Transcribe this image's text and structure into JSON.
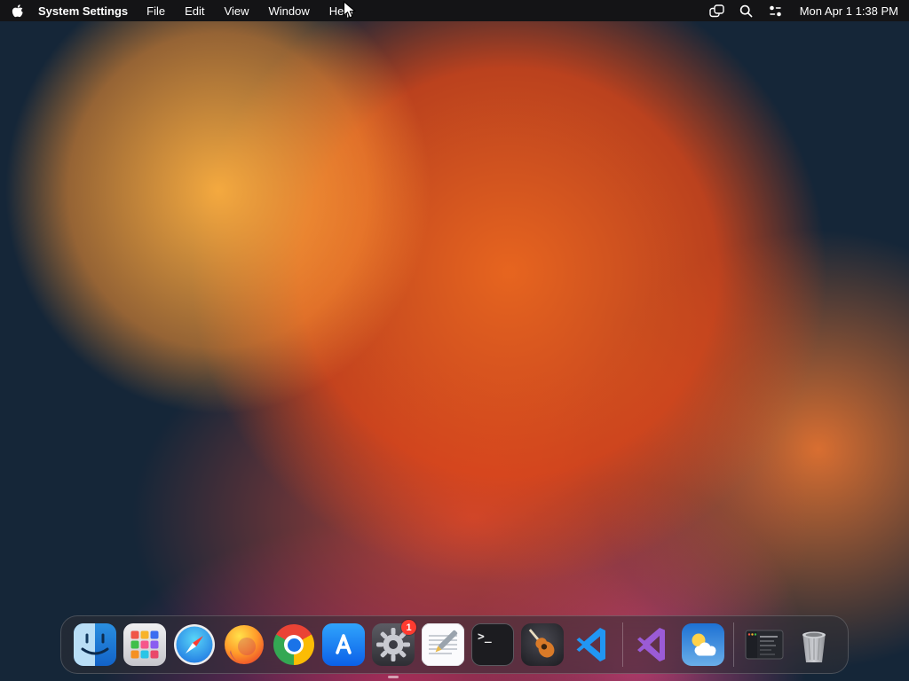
{
  "menubar": {
    "app_name": "System Settings",
    "menus": [
      {
        "label": "File"
      },
      {
        "label": "Edit"
      },
      {
        "label": "View"
      },
      {
        "label": "Window"
      },
      {
        "label": "Help"
      }
    ],
    "status_icons": [
      "stage-manager-icon",
      "search-icon",
      "control-center-icon"
    ],
    "status": {
      "clock": "Mon Apr 1 1:38 PM"
    }
  },
  "dock": {
    "settings_badge": "1",
    "terminal_glyph": ">_",
    "items": [
      {
        "name": "finder"
      },
      {
        "name": "launchpad"
      },
      {
        "name": "safari"
      },
      {
        "name": "firefox"
      },
      {
        "name": "chrome"
      },
      {
        "name": "app-store"
      },
      {
        "name": "system-settings",
        "badge": "1"
      },
      {
        "name": "textedit"
      },
      {
        "name": "terminal"
      },
      {
        "name": "garageband"
      },
      {
        "name": "vscode"
      },
      {
        "name": "visual-studio"
      },
      {
        "name": "weather"
      },
      {
        "name": "minimized-window"
      },
      {
        "name": "trash"
      }
    ]
  },
  "colors": {
    "menubar_bg": "#141416",
    "dock_bg": "rgba(46,46,52,0.55)",
    "badge_red": "#ff3b30",
    "wallpaper_base": "#152638"
  }
}
